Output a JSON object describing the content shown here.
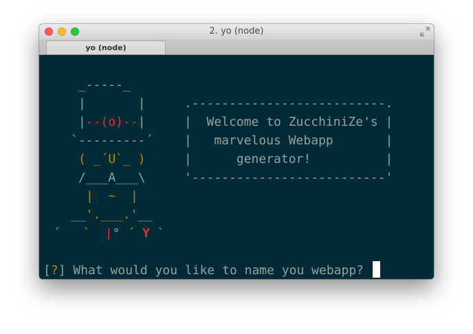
{
  "window": {
    "title": "2. yo (node)",
    "tab_label": "yo (node)"
  },
  "colors": {
    "terminal_bg": "#002b36",
    "text": "#93a1a1",
    "red": "#dc322f",
    "yellow": "#b58900",
    "cyan": "#2aa198"
  },
  "yeoman": {
    "hat_top": " _-----_",
    "hat_side": "|       |",
    "eyes_left": "|",
    "eyes": "--(o)--",
    "eyes_right": "|",
    "brim": "`---------´",
    "face": "( _´U`_ )",
    "arms": "/___A___\\",
    "belt": "|  ~  |",
    "legs_a": "__",
    "legs_b": "'.___.'",
    "legs_c": "__",
    "feet_a": "´   ",
    "feet_b": "`  ",
    "feet_c": "|",
    "feet_d": "° ",
    "feet_e": "´ ",
    "feet_f": "Y",
    "feet_g": " `"
  },
  "greeting": {
    "top_border": ".--------------------------.",
    "line1": "|  Welcome to ZucchiniZe's |",
    "line2": "|   marvelous Webapp       |",
    "line3": "|      generator!          |",
    "bottom_border": "'--------------------------'"
  },
  "prompt": {
    "open": "[",
    "mark": "?",
    "close": "]",
    "question": " What would you like to name you webapp? "
  }
}
